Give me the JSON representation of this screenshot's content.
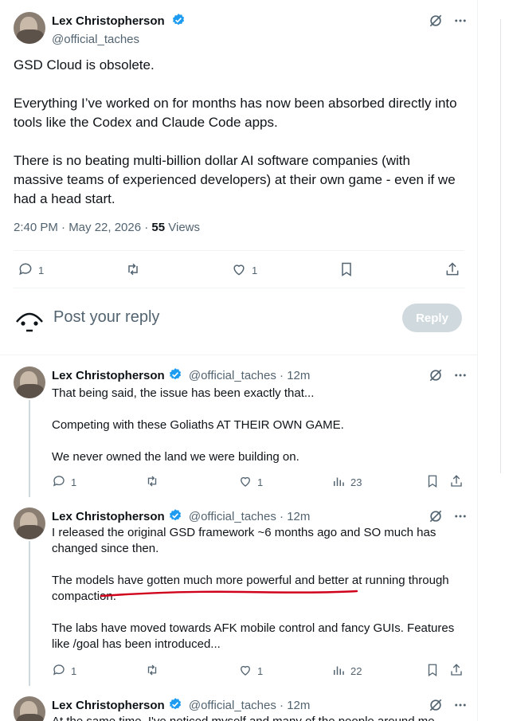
{
  "main_tweet": {
    "author_name": "Lex Christopherson",
    "author_handle": "@official_taches",
    "paragraphs": [
      "GSD Cloud is obsolete.",
      "Everything I’ve worked on for months has now been absorbed directly into tools like the Codex and Claude Code apps.",
      "There is no beating multi-billion dollar AI software companies (with massive teams of experienced developers) at their own game - even if we had a head start."
    ],
    "timestamp": "2:40 PM · May 22, 2026 · ",
    "views_count": "55",
    "views_label": " Views",
    "reply_count": "1",
    "like_count": "1"
  },
  "reply_composer": {
    "placeholder": "Post your reply",
    "button_label": "Reply"
  },
  "replies": [
    {
      "author_name": "Lex Christopherson",
      "author_handle": "@official_taches",
      "time": " · 12m",
      "paragraphs": [
        "That being said, the issue has been exactly that...",
        "Competing with these Goliaths AT THEIR OWN GAME.",
        "We never owned the land we were building on."
      ],
      "reply_count": "1",
      "like_count": "1",
      "views_count": "23"
    },
    {
      "author_name": "Lex Christopherson",
      "author_handle": "@official_taches",
      "time": " · 12m",
      "paragraphs": [
        "I released the original GSD framework ~6 months ago and SO much has changed since then.",
        "The models have gotten much more powerful and better at running through compaction.",
        "The labs have moved towards AFK mobile control and fancy GUIs. Features like /goal has been introduced..."
      ],
      "reply_count": "1",
      "like_count": "1",
      "views_count": "22"
    },
    {
      "author_name": "Lex Christopherson",
      "author_handle": "@official_taches",
      "time": " · 12m",
      "paragraphs": [
        "At the same time, I've noticed myself and many of the people around me"
      ]
    }
  ],
  "colors": {
    "verified": "#1d9bf0",
    "muted": "#536471",
    "annotation_underline": "#d0021b"
  },
  "icons": [
    "verified-badge-icon",
    "grok-icon",
    "more-icon",
    "reply-icon",
    "retweet-icon",
    "like-icon",
    "bookmark-icon",
    "share-icon",
    "views-icon"
  ]
}
